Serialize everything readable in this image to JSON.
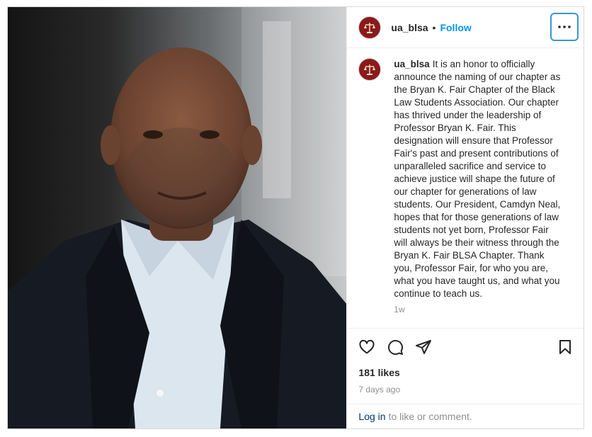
{
  "account": {
    "username": "ua_blsa"
  },
  "header": {
    "separator": "•",
    "follow_label": "Follow",
    "more_icon": "more-horizontal-icon"
  },
  "caption": {
    "username": "ua_blsa",
    "text": "It is an honor to officially announce the naming of our chapter as the Bryan K. Fair Chapter of the Black Law Students Association. Our chapter has thrived under the leadership of Professor Bryan K. Fair. This designation will ensure that Professor Fair's past and present contributions of unparalleled sacrifice and service to achieve justice will shape the future of our chapter for generations of law students. Our President, Camdyn Neal, hopes that for those generations of law students not yet born, Professor Fair will always be their witness through the Bryan K. Fair BLSA Chapter. Thank you, Professor Fair, for who you are, what you have taught us, and what you continue to teach us.",
    "age": "1w"
  },
  "actions": {
    "like_icon": "heart-icon",
    "comment_icon": "comment-icon",
    "share_icon": "share-icon",
    "save_icon": "bookmark-icon"
  },
  "stats": {
    "likes": "181 likes",
    "posted": "7 days ago"
  },
  "footer": {
    "login_link": "Log in",
    "login_text": "to like or comment."
  },
  "colors": {
    "follow": "#0095f6",
    "avatar": "#8b1a1a",
    "focus_ring": "#3897d6"
  }
}
